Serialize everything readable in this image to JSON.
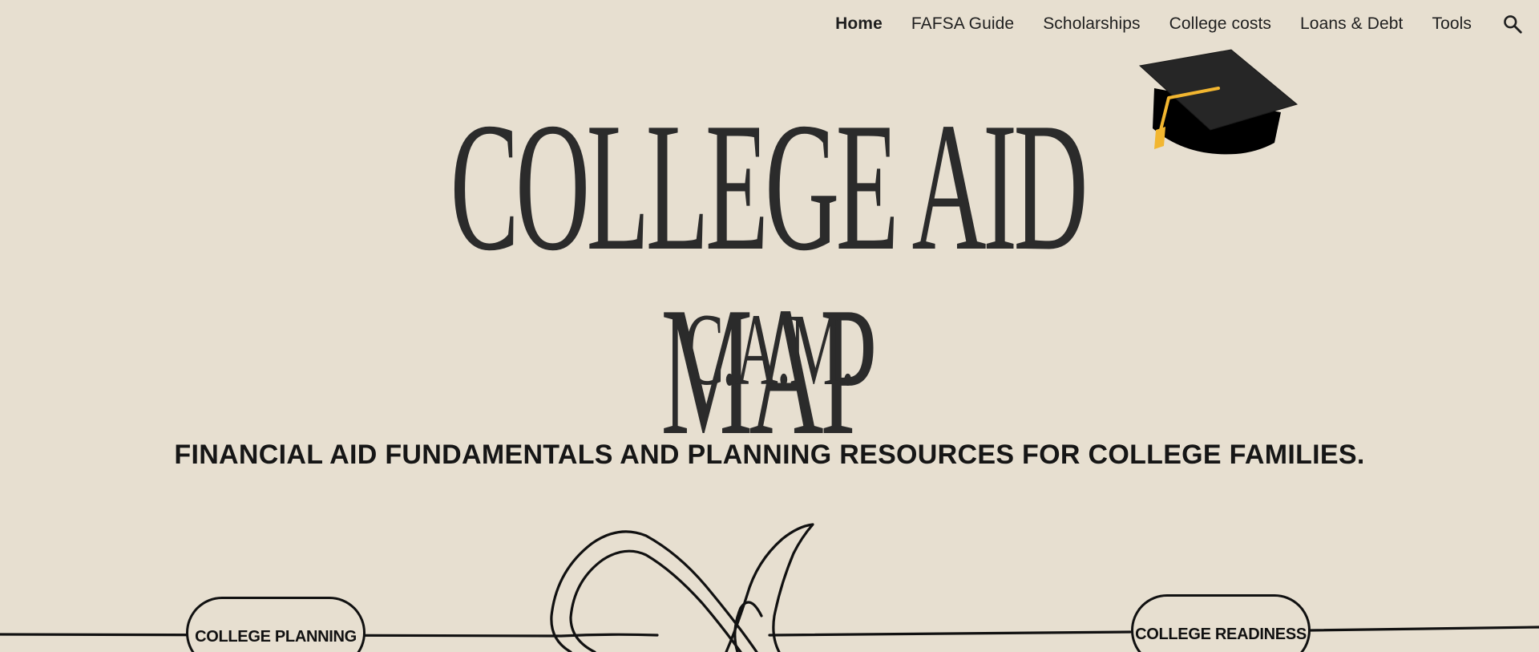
{
  "nav": {
    "items": [
      {
        "label": "Home",
        "active": true
      },
      {
        "label": "FAFSA Guide",
        "active": false
      },
      {
        "label": "Scholarships",
        "active": false
      },
      {
        "label": "College costs",
        "active": false
      },
      {
        "label": "Loans & Debt",
        "active": false
      },
      {
        "label": "Tools",
        "active": false
      }
    ],
    "search_icon": "search-icon"
  },
  "hero": {
    "title": "COLLEGE AID MAP",
    "abbreviation": "C.A.M.",
    "tagline": "FINANCIAL AID FUNDAMENTALS AND PLANNING RESOURCES FOR COLLEGE FAMILIES.",
    "decoration_icon": "graduation-cap-icon"
  },
  "pathway": {
    "left_pill": "COLLEGE PLANNING",
    "right_pill": "COLLEGE READINESS"
  },
  "colors": {
    "background": "#e7dfd0",
    "text": "#1c1c1c",
    "title": "#2b2b2b",
    "cap_tassel": "#f2b630",
    "cap": "#232323"
  }
}
